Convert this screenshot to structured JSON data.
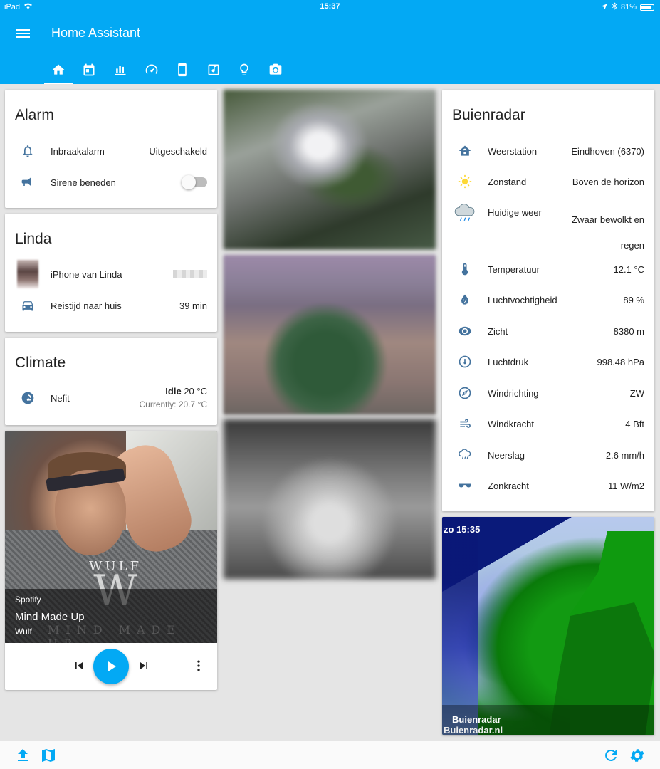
{
  "status_bar": {
    "device": "iPad",
    "time": "15:37",
    "battery": "81%"
  },
  "app": {
    "title": "Home Assistant"
  },
  "tabs": [
    {
      "icon": "home-icon"
    },
    {
      "icon": "calendar-icon"
    },
    {
      "icon": "bar-chart-icon"
    },
    {
      "icon": "speedometer-icon"
    },
    {
      "icon": "tablet-icon"
    },
    {
      "icon": "music-note-icon"
    },
    {
      "icon": "lightbulb-icon"
    },
    {
      "icon": "camera-icon"
    }
  ],
  "alarm": {
    "title": "Alarm",
    "rows": [
      {
        "label": "Inbraakalarm",
        "value": "Uitgeschakeld"
      },
      {
        "label": "Sirene beneden",
        "toggle": false
      }
    ]
  },
  "linda": {
    "title": "Linda",
    "rows": [
      {
        "label": "iPhone van Linda"
      },
      {
        "label": "Reistijd naar huis",
        "value": "39 min"
      }
    ]
  },
  "climate": {
    "title": "Climate",
    "device": "Nefit",
    "state": "Idle",
    "target": "20 °C",
    "current": "Currently: 20.7 °C"
  },
  "media": {
    "player": "Spotify",
    "track": "Mind Made Up",
    "artist": "Wulf",
    "art_logo": "WULF",
    "art_text": "MIND MADE UP"
  },
  "buienradar": {
    "title": "Buienradar",
    "rows": [
      {
        "label": "Weerstation",
        "value": "Eindhoven (6370)",
        "icon": "home-icon"
      },
      {
        "label": "Zonstand",
        "value": "Boven de horizon",
        "icon": "sun-icon"
      },
      {
        "label": "Huidige weer",
        "value": "Zwaar bewolkt en",
        "value2": "regen",
        "icon": "rain-cloud-icon"
      },
      {
        "label": "Temperatuur",
        "value": "12.1 °C",
        "icon": "thermometer-icon"
      },
      {
        "label": "Luchtvochtigheid",
        "value": "89 %",
        "icon": "water-percent-icon"
      },
      {
        "label": "Zicht",
        "value": "8380 m",
        "icon": "eye-icon"
      },
      {
        "label": "Luchtdruk",
        "value": "998.48 hPa",
        "icon": "gauge-icon"
      },
      {
        "label": "Windrichting",
        "value": "ZW",
        "icon": "compass-icon"
      },
      {
        "label": "Windkracht",
        "value": "4 Bft",
        "icon": "wind-icon"
      },
      {
        "label": "Neerslag",
        "value": "2.6 mm/h",
        "icon": "rain-icon"
      },
      {
        "label": "Zonkracht",
        "value": "11 W/m2",
        "icon": "sunglasses-icon"
      }
    ]
  },
  "radar": {
    "time": "zo 15:35",
    "name": "Buienradar",
    "watermark": "Buienradar.nl"
  },
  "colors": {
    "primary": "#03a9f4",
    "icon": "#44739e",
    "background": "#e5e5e5"
  }
}
